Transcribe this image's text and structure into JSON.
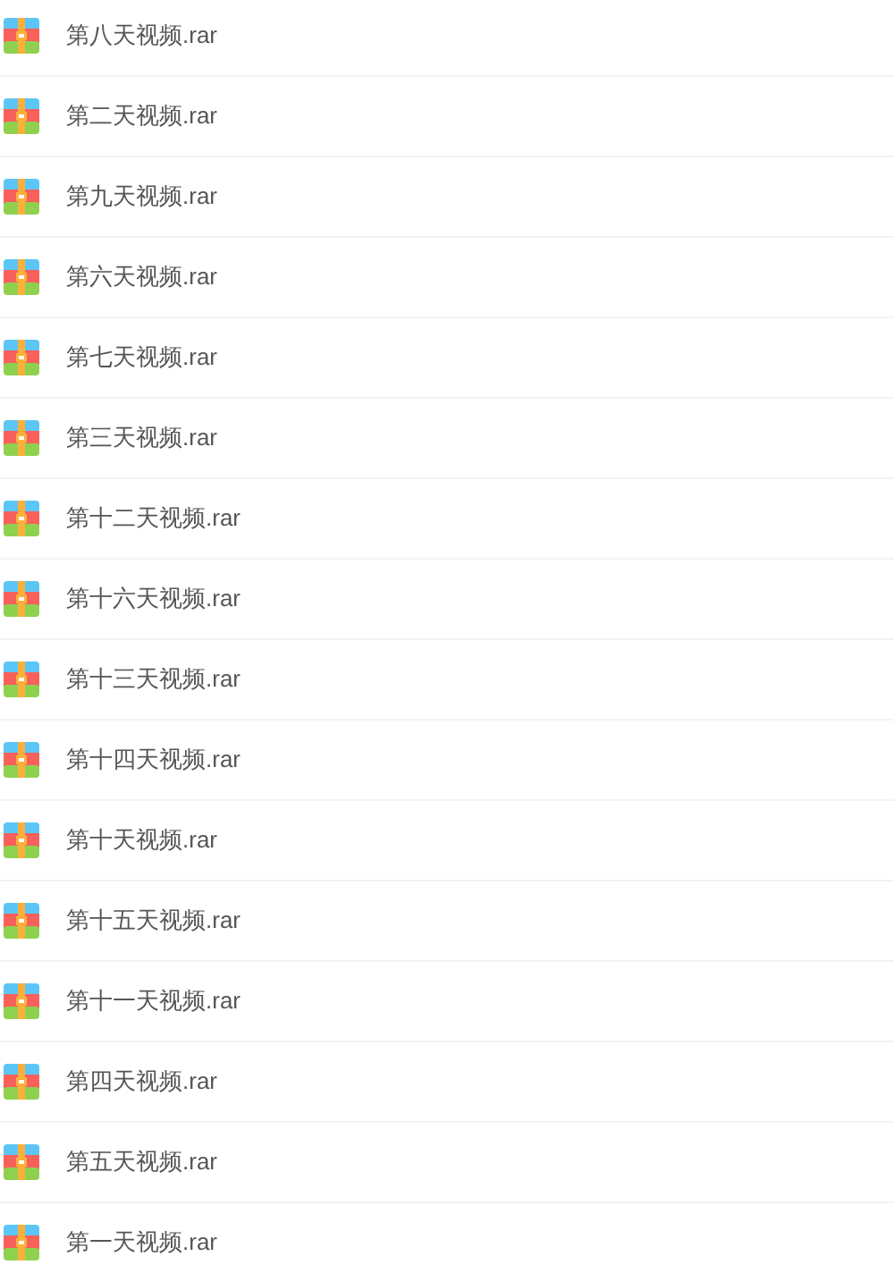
{
  "files": [
    {
      "name": "第八天视频.rar"
    },
    {
      "name": "第二天视频.rar"
    },
    {
      "name": "第九天视频.rar"
    },
    {
      "name": "第六天视频.rar"
    },
    {
      "name": "第七天视频.rar"
    },
    {
      "name": "第三天视频.rar"
    },
    {
      "name": "第十二天视频.rar"
    },
    {
      "name": "第十六天视频.rar"
    },
    {
      "name": "第十三天视频.rar"
    },
    {
      "name": "第十四天视频.rar"
    },
    {
      "name": "第十天视频.rar"
    },
    {
      "name": "第十五天视频.rar"
    },
    {
      "name": "第十一天视频.rar"
    },
    {
      "name": "第四天视频.rar"
    },
    {
      "name": "第五天视频.rar"
    },
    {
      "name": "第一天视频.rar"
    }
  ]
}
